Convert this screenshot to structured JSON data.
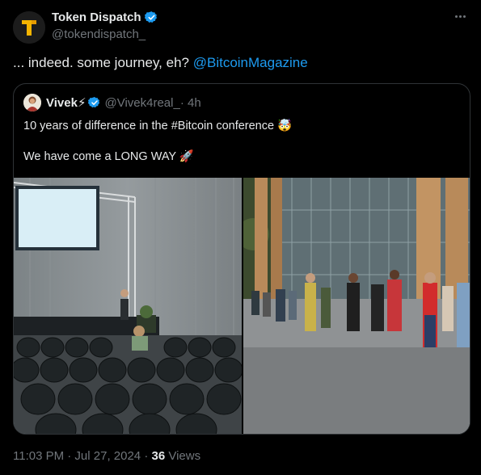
{
  "tweet": {
    "author_name": "Token Dispatch",
    "author_handle": "@tokendispatch_",
    "avatar_letter": "T",
    "text_before": "... indeed. some journey, eh? ",
    "mention": "@BitcoinMagazine",
    "timestamp": "11:03 PM · Jul 27, 2024 · ",
    "views_count": "36",
    "views_label": " Views"
  },
  "quote": {
    "author_name": "Vivek",
    "author_emoji": "⚡",
    "author_handle": "@Vivek4real_",
    "time": " · 4h",
    "line1": "10 years of difference in the #Bitcoin conference 🤯",
    "line2": "We have come a LONG WAY 🚀"
  },
  "colors": {
    "background": "#000000",
    "text": "#e7e9ea",
    "muted": "#71767b",
    "link": "#1d9bf0",
    "verified": "#1d9bf0",
    "border": "#2f3336",
    "avatar_accent": "#f5b400"
  },
  "icons": {
    "verified": "verified-badge-icon",
    "more": "more-options-icon"
  }
}
